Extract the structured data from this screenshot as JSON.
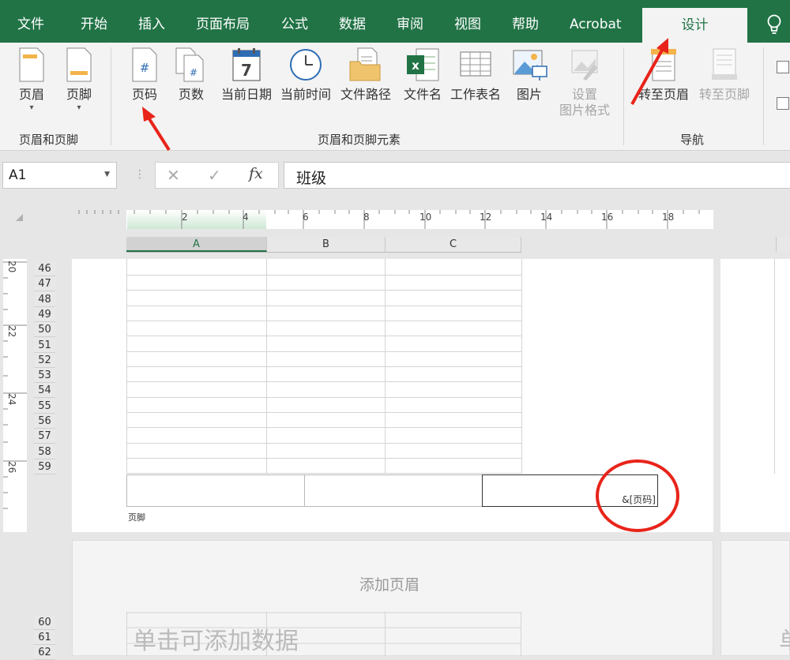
{
  "tabs": [
    "文件",
    "开始",
    "插入",
    "页面布局",
    "公式",
    "数据",
    "审阅",
    "视图",
    "帮助",
    "Acrobat"
  ],
  "active_tab": "设计",
  "tell_me_icon": "lightbulb-icon",
  "ribbon": {
    "groups": {
      "header_footer": "页眉和页脚",
      "elements": "页眉和页脚元素",
      "navigation": "导航"
    },
    "buttons": {
      "header": "页眉",
      "footer": "页脚",
      "page_number": "页码",
      "page_count": "页数",
      "current_date": "当前日期",
      "current_time": "当前时间",
      "file_path": "文件路径",
      "file_name": "文件名",
      "sheet_name": "工作表名",
      "picture": "图片",
      "format_picture_1": "设置",
      "format_picture_2": "图片格式",
      "goto_header": "转至页眉",
      "goto_footer": "转至页脚"
    },
    "icons": {
      "page_number_glyph": "#",
      "date_glyph": "7",
      "excel_glyph": "x"
    }
  },
  "formula_bar": {
    "name_box": "A1",
    "fx": "fx",
    "value": "班级"
  },
  "ruler": [
    "2",
    "4",
    "6",
    "8",
    "10",
    "12",
    "14",
    "16",
    "18"
  ],
  "ruler_vertical": [
    "20",
    "22",
    "24",
    "26"
  ],
  "columns": [
    "A",
    "B",
    "C"
  ],
  "rows": [
    "46",
    "47",
    "48",
    "49",
    "50",
    "51",
    "52",
    "53",
    "54",
    "55",
    "56",
    "57",
    "58",
    "59"
  ],
  "rows_page2": [
    "60",
    "61",
    "62"
  ],
  "footer": {
    "code": "&[页码]",
    "label": "页脚"
  },
  "next_page": {
    "add_header": "添加页眉",
    "add_data": "单击可添加数据",
    "right_partial": "单"
  },
  "colors": {
    "accent": "#217346",
    "annotation": "#e8241a"
  }
}
